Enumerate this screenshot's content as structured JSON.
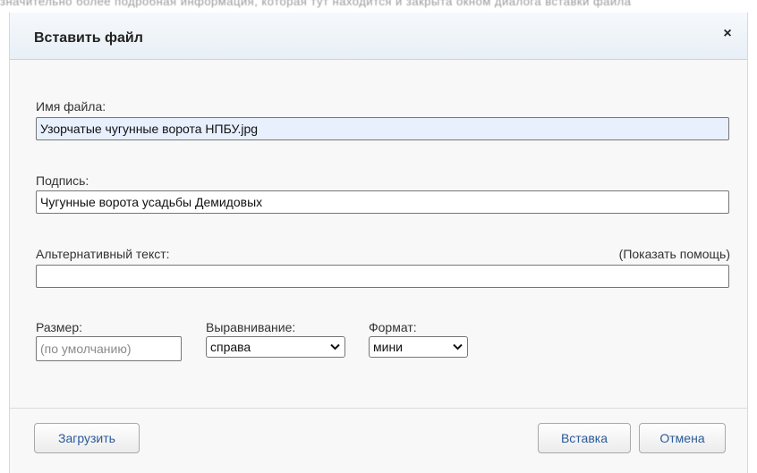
{
  "background": {
    "blurred_text": "значительно более подробная информация, которая тут находится и закрыта окном диалога вставки файла"
  },
  "dialog": {
    "title": "Вставить файл",
    "close_symbol": "×"
  },
  "fields": {
    "filename": {
      "label": "Имя файла:",
      "value": "Узорчатые чугунные ворота НПБУ.jpg"
    },
    "caption": {
      "label": "Подпись:",
      "value": "Чугунные ворота усадьбы Демидовых"
    },
    "alt": {
      "label": "Альтернативный текст:",
      "value": "",
      "help_link": "(Показать помощь)"
    },
    "size": {
      "label": "Размер:",
      "placeholder": "(по умолчанию)"
    },
    "align": {
      "label": "Выравнивание:",
      "selected": "справа"
    },
    "format": {
      "label": "Формат:",
      "selected": "мини"
    }
  },
  "buttons": {
    "upload": "Загрузить",
    "insert": "Вставка",
    "cancel": "Отмена"
  },
  "colors": {
    "title_bar": "#e8eff6",
    "autofill_bg": "#e8f0fe",
    "button_text": "#2a5a9a"
  }
}
